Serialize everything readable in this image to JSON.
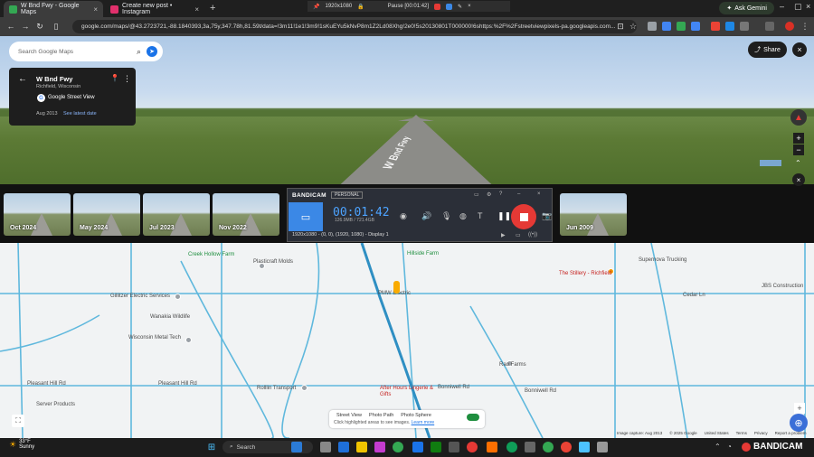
{
  "browser": {
    "tabs": [
      {
        "label": "W Bnd Fwy - Google Maps",
        "active": true,
        "favicon_color": "#34a853"
      },
      {
        "label": "Create new post • Instagram",
        "active": false,
        "favicon_color": "#e1306c"
      }
    ],
    "new_tab": "+",
    "url": "google.com/maps/@43.2723721,-88.1840393,3a,75y,347.78h,81.59t/data=!3m11!1e1!3m9!1sKuEYu5kNvP8m1Z2Ld08Xhg!2e0!5s20130801T000000!6shttps:%2F%2Fstreetviewpixels-pa.googleapis.com...",
    "ask_gemini": "Ask Gemini"
  },
  "recorder_bar": {
    "resolution": "1920x1080",
    "pause_label": "Pause [00:01:42]"
  },
  "maps": {
    "search_placeholder": "Search Google Maps",
    "card": {
      "title": "W Bnd Fwy",
      "subtitle": "Richfield, Wisconsin",
      "provider": "Google Street View",
      "date": "Aug 2013",
      "latest_link": "See latest date"
    },
    "share": "Share",
    "timeline": [
      "Oct 2024",
      "May 2024",
      "Jul 2023",
      "Nov 2022",
      "Jun 2009"
    ],
    "street_road_sign": "W Bnd Fwy"
  },
  "bandicam": {
    "logo": "BANDICAM",
    "edition": "PERSONAL",
    "timer": "00:01:42",
    "size": "126.9MB / 721.4GB",
    "footer": "1920x1080 - (0, 0), (1920, 1080) - Display 1"
  },
  "map_labels": {
    "places": [
      {
        "name": "Creek Hollow Farm",
        "kind": "green"
      },
      {
        "name": "Plasticraft Molds",
        "kind": "plain"
      },
      {
        "name": "Hillside Farm",
        "kind": "green"
      },
      {
        "name": "The Stillery - Richfield",
        "kind": "pink"
      },
      {
        "name": "Supernova Trucking",
        "kind": "plain"
      },
      {
        "name": "Gillitzer Electric Services",
        "kind": "plain"
      },
      {
        "name": "PMW Electric",
        "kind": "plain"
      },
      {
        "name": "Wanakia Wildlife",
        "kind": "plain"
      },
      {
        "name": "Wisconsin Metal Tech",
        "kind": "plain"
      },
      {
        "name": "JBS Construction",
        "kind": "plain"
      },
      {
        "name": "Rao Farms",
        "kind": "plain"
      },
      {
        "name": "Rolllin Transport",
        "kind": "plain"
      },
      {
        "name": "After Hours Lingerie & Gifts",
        "kind": "pink"
      },
      {
        "name": "Server Products",
        "kind": "plain"
      }
    ],
    "roads": [
      "Mayfield Rd",
      "Pleasant Hill Rd",
      "Bonniwell Rd",
      "Cedar Ln",
      "Shadow Ln",
      "Goldendale Rd",
      "Maple Rd"
    ]
  },
  "legend": {
    "items": [
      "Street View",
      "Photo Path",
      "Photo Sphere"
    ],
    "hint": "Click highlighted areas to see images.",
    "learn_more": "Learn more"
  },
  "attribution": [
    "Image capture: Aug 2013",
    "© 2025 Google",
    "United States",
    "Terms",
    "Privacy",
    "Report a problem"
  ],
  "taskbar": {
    "temp": "33°F",
    "weather": "Sunny",
    "search": "Search",
    "brand": "BANDICAM"
  }
}
